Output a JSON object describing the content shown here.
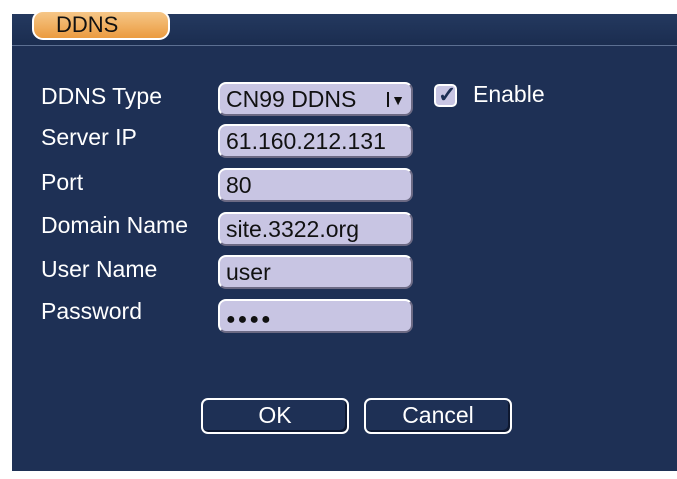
{
  "window": {
    "title": "DDNS"
  },
  "form": {
    "ddns_type": {
      "label": "DDNS Type",
      "value": "CN99 DDNS",
      "enable_label": "Enable",
      "enabled": true
    },
    "server_ip": {
      "label": "Server IP",
      "value": "61.160.212.131"
    },
    "port": {
      "label": "Port",
      "value": "80"
    },
    "domain_name": {
      "label": "Domain Name",
      "value": "site.3322.org"
    },
    "user_name": {
      "label": "User Name",
      "value": "user"
    },
    "password": {
      "label": "Password",
      "value": "●●●●"
    }
  },
  "buttons": {
    "ok_label": "OK",
    "cancel_label": "Cancel"
  },
  "icons": {
    "dropdown": "chevron-down-icon",
    "checkbox": "checkmark-icon"
  }
}
